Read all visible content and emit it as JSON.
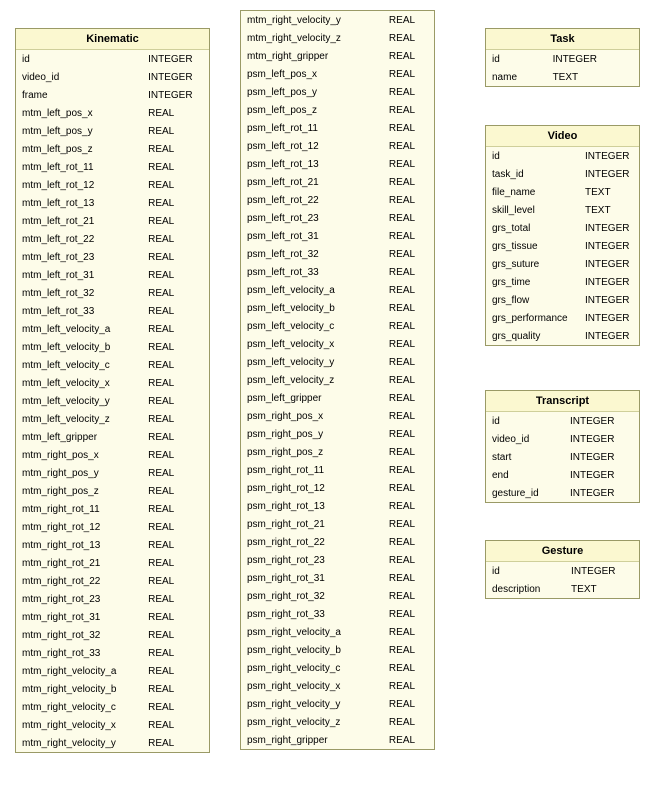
{
  "tables": {
    "kinematic": {
      "title": "Kinematic",
      "columns": [
        {
          "name": "id",
          "type": "INTEGER"
        },
        {
          "name": "video_id",
          "type": "INTEGER"
        },
        {
          "name": "frame",
          "type": "INTEGER"
        },
        {
          "name": "mtm_left_pos_x",
          "type": "REAL"
        },
        {
          "name": "mtm_left_pos_y",
          "type": "REAL"
        },
        {
          "name": "mtm_left_pos_z",
          "type": "REAL"
        },
        {
          "name": "mtm_left_rot_11",
          "type": "REAL"
        },
        {
          "name": "mtm_left_rot_12",
          "type": "REAL"
        },
        {
          "name": "mtm_left_rot_13",
          "type": "REAL"
        },
        {
          "name": "mtm_left_rot_21",
          "type": "REAL"
        },
        {
          "name": "mtm_left_rot_22",
          "type": "REAL"
        },
        {
          "name": "mtm_left_rot_23",
          "type": "REAL"
        },
        {
          "name": "mtm_left_rot_31",
          "type": "REAL"
        },
        {
          "name": "mtm_left_rot_32",
          "type": "REAL"
        },
        {
          "name": "mtm_left_rot_33",
          "type": "REAL"
        },
        {
          "name": "mtm_left_velocity_a",
          "type": "REAL"
        },
        {
          "name": "mtm_left_velocity_b",
          "type": "REAL"
        },
        {
          "name": "mtm_left_velocity_c",
          "type": "REAL"
        },
        {
          "name": "mtm_left_velocity_x",
          "type": "REAL"
        },
        {
          "name": "mtm_left_velocity_y",
          "type": "REAL"
        },
        {
          "name": "mtm_left_velocity_z",
          "type": "REAL"
        },
        {
          "name": "mtm_left_gripper",
          "type": "REAL"
        },
        {
          "name": "mtm_right_pos_x",
          "type": "REAL"
        },
        {
          "name": "mtm_right_pos_y",
          "type": "REAL"
        },
        {
          "name": "mtm_right_pos_z",
          "type": "REAL"
        },
        {
          "name": "mtm_right_rot_11",
          "type": "REAL"
        },
        {
          "name": "mtm_right_rot_12",
          "type": "REAL"
        },
        {
          "name": "mtm_right_rot_13",
          "type": "REAL"
        },
        {
          "name": "mtm_right_rot_21",
          "type": "REAL"
        },
        {
          "name": "mtm_right_rot_22",
          "type": "REAL"
        },
        {
          "name": "mtm_right_rot_23",
          "type": "REAL"
        },
        {
          "name": "mtm_right_rot_31",
          "type": "REAL"
        },
        {
          "name": "mtm_right_rot_32",
          "type": "REAL"
        },
        {
          "name": "mtm_right_rot_33",
          "type": "REAL"
        },
        {
          "name": "mtm_right_velocity_a",
          "type": "REAL"
        },
        {
          "name": "mtm_right_velocity_b",
          "type": "REAL"
        },
        {
          "name": "mtm_right_velocity_c",
          "type": "REAL"
        },
        {
          "name": "mtm_right_velocity_x",
          "type": "REAL"
        },
        {
          "name": "mtm_right_velocity_y",
          "type": "REAL"
        }
      ]
    },
    "kinematic2": {
      "title": "",
      "columns": [
        {
          "name": "mtm_right_velocity_y",
          "type": "REAL"
        },
        {
          "name": "mtm_right_velocity_z",
          "type": "REAL"
        },
        {
          "name": "mtm_right_gripper",
          "type": "REAL"
        },
        {
          "name": "psm_left_pos_x",
          "type": "REAL"
        },
        {
          "name": "psm_left_pos_y",
          "type": "REAL"
        },
        {
          "name": "psm_left_pos_z",
          "type": "REAL"
        },
        {
          "name": "psm_left_rot_11",
          "type": "REAL"
        },
        {
          "name": "psm_left_rot_12",
          "type": "REAL"
        },
        {
          "name": "psm_left_rot_13",
          "type": "REAL"
        },
        {
          "name": "psm_left_rot_21",
          "type": "REAL"
        },
        {
          "name": "psm_left_rot_22",
          "type": "REAL"
        },
        {
          "name": "psm_left_rot_23",
          "type": "REAL"
        },
        {
          "name": "psm_left_rot_31",
          "type": "REAL"
        },
        {
          "name": "psm_left_rot_32",
          "type": "REAL"
        },
        {
          "name": "psm_left_rot_33",
          "type": "REAL"
        },
        {
          "name": "psm_left_velocity_a",
          "type": "REAL"
        },
        {
          "name": "psm_left_velocity_b",
          "type": "REAL"
        },
        {
          "name": "psm_left_velocity_c",
          "type": "REAL"
        },
        {
          "name": "psm_left_velocity_x",
          "type": "REAL"
        },
        {
          "name": "psm_left_velocity_y",
          "type": "REAL"
        },
        {
          "name": "psm_left_velocity_z",
          "type": "REAL"
        },
        {
          "name": "psm_left_gripper",
          "type": "REAL"
        },
        {
          "name": "psm_right_pos_x",
          "type": "REAL"
        },
        {
          "name": "psm_right_pos_y",
          "type": "REAL"
        },
        {
          "name": "psm_right_pos_z",
          "type": "REAL"
        },
        {
          "name": "psm_right_rot_11",
          "type": "REAL"
        },
        {
          "name": "psm_right_rot_12",
          "type": "REAL"
        },
        {
          "name": "psm_right_rot_13",
          "type": "REAL"
        },
        {
          "name": "psm_right_rot_21",
          "type": "REAL"
        },
        {
          "name": "psm_right_rot_22",
          "type": "REAL"
        },
        {
          "name": "psm_right_rot_23",
          "type": "REAL"
        },
        {
          "name": "psm_right_rot_31",
          "type": "REAL"
        },
        {
          "name": "psm_right_rot_32",
          "type": "REAL"
        },
        {
          "name": "psm_right_rot_33",
          "type": "REAL"
        },
        {
          "name": "psm_right_velocity_a",
          "type": "REAL"
        },
        {
          "name": "psm_right_velocity_b",
          "type": "REAL"
        },
        {
          "name": "psm_right_velocity_c",
          "type": "REAL"
        },
        {
          "name": "psm_right_velocity_x",
          "type": "REAL"
        },
        {
          "name": "psm_right_velocity_y",
          "type": "REAL"
        },
        {
          "name": "psm_right_velocity_z",
          "type": "REAL"
        },
        {
          "name": "psm_right_gripper",
          "type": "REAL"
        }
      ]
    },
    "task": {
      "title": "Task",
      "columns": [
        {
          "name": "id",
          "type": "INTEGER"
        },
        {
          "name": "name",
          "type": "TEXT"
        }
      ]
    },
    "video": {
      "title": "Video",
      "columns": [
        {
          "name": "id",
          "type": "INTEGER"
        },
        {
          "name": "task_id",
          "type": "INTEGER"
        },
        {
          "name": "file_name",
          "type": "TEXT"
        },
        {
          "name": "skill_level",
          "type": "TEXT"
        },
        {
          "name": "grs_total",
          "type": "INTEGER"
        },
        {
          "name": "grs_tissue",
          "type": "INTEGER"
        },
        {
          "name": "grs_suture",
          "type": "INTEGER"
        },
        {
          "name": "grs_time",
          "type": "INTEGER"
        },
        {
          "name": "grs_flow",
          "type": "INTEGER"
        },
        {
          "name": "grs_performance",
          "type": "INTEGER"
        },
        {
          "name": "grs_quality",
          "type": "INTEGER"
        }
      ]
    },
    "transcript": {
      "title": "Transcript",
      "columns": [
        {
          "name": "id",
          "type": "INTEGER"
        },
        {
          "name": "video_id",
          "type": "INTEGER"
        },
        {
          "name": "start",
          "type": "INTEGER"
        },
        {
          "name": "end",
          "type": "INTEGER"
        },
        {
          "name": "gesture_id",
          "type": "INTEGER"
        }
      ]
    },
    "gesture": {
      "title": "Gesture",
      "columns": [
        {
          "name": "id",
          "type": "INTEGER"
        },
        {
          "name": "description",
          "type": "TEXT"
        }
      ]
    }
  }
}
